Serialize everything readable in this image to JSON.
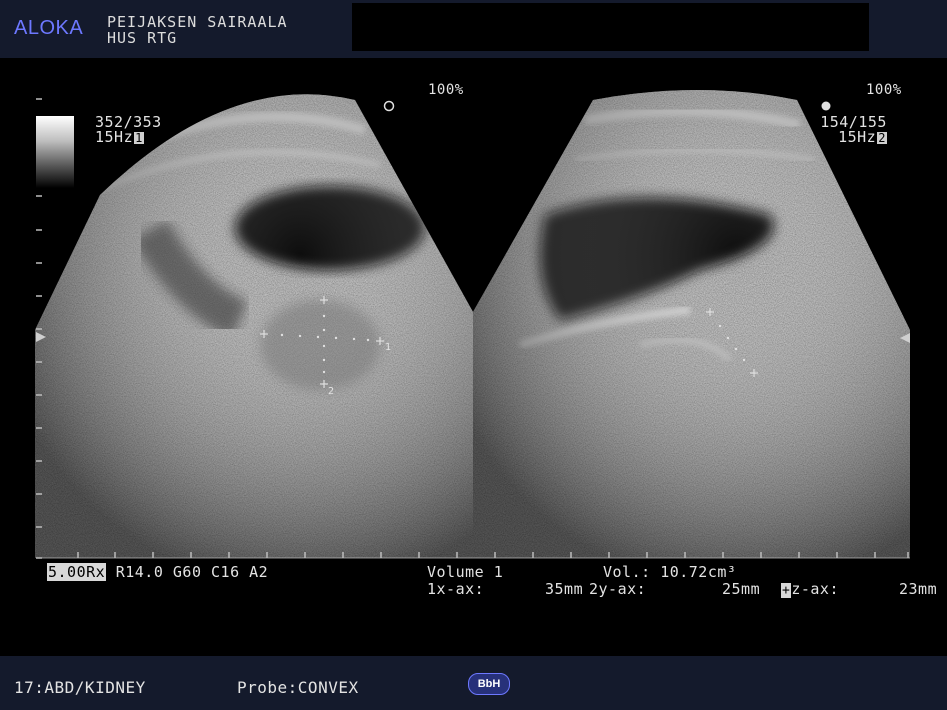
{
  "header": {
    "logo": "ALOKA",
    "institution_line1": "PEIJAKSEN SAIRAALA",
    "institution_line2": "HUS RTG"
  },
  "left_image": {
    "zoom": "100%",
    "frame": "352/353",
    "rate": "15Hz",
    "rate_index": "1",
    "caliper_labels": [
      "1",
      "2"
    ]
  },
  "right_image": {
    "zoom": "100%",
    "frame": "154/155",
    "rate": "15Hz",
    "rate_index": "2"
  },
  "settings": {
    "frequency": "5.00Rx",
    "params": "R14.0 G60 C16 A2"
  },
  "measurement": {
    "title": "Volume 1",
    "vol_label": "Vol.:",
    "vol_value": "10.72cm³",
    "x_axis_label": "1x-ax:",
    "x_axis_value": "35mm",
    "y_axis_label": "2y-ax:",
    "y_axis_value": "25mm",
    "z_axis_label": "z-ax:",
    "z_axis_value": "23mm"
  },
  "footer": {
    "preset": "17:ABD/KIDNEY",
    "probe": "Probe:CONVEX",
    "badge": "BbH"
  },
  "colors": {
    "header_bg": "#141a2c",
    "logo": "#6d78ff",
    "badge_bg": "#27317a"
  }
}
